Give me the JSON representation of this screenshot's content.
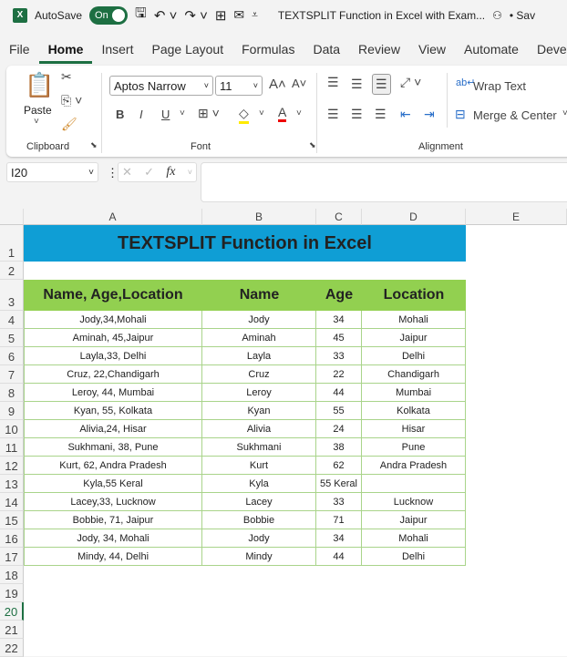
{
  "titlebar": {
    "autosave_label": "AutoSave",
    "autosave_state": "On",
    "doc_title": "TEXTSPLIT Function in Excel with Exam...",
    "save_status": "• Sav"
  },
  "tabs": [
    "File",
    "Home",
    "Insert",
    "Page Layout",
    "Formulas",
    "Data",
    "Review",
    "View",
    "Automate",
    "Develo"
  ],
  "ribbon": {
    "paste": "Paste",
    "clipboard": "Clipboard",
    "font_name": "Aptos Narrow",
    "font_size": "11",
    "font": "Font",
    "alignment": "Alignment",
    "wrap_text": "Wrap Text",
    "merge_center": "Merge & Center",
    "bold": "B",
    "italic": "I",
    "underline": "U"
  },
  "formula_bar": {
    "name_box": "I20",
    "fx": "fx",
    "value": ""
  },
  "columns": [
    "A",
    "B",
    "C",
    "D",
    "E"
  ],
  "rows": [
    "1",
    "2",
    "3",
    "4",
    "5",
    "6",
    "7",
    "8",
    "9",
    "10",
    "11",
    "12",
    "13",
    "14",
    "15",
    "16",
    "17",
    "18",
    "19",
    "20",
    "21",
    "22"
  ],
  "sheet": {
    "title": "TEXTSPLIT Function in Excel",
    "headers": [
      "Name, Age,Location",
      "Name",
      "Age",
      "Location"
    ],
    "data": [
      [
        "Jody,34,Mohali",
        "Jody",
        "34",
        "Mohali"
      ],
      [
        "Aminah, 45,Jaipur",
        "Aminah",
        "45",
        "Jaipur"
      ],
      [
        "Layla,33, Delhi",
        "Layla",
        "33",
        "Delhi"
      ],
      [
        "Cruz, 22,Chandigarh",
        "Cruz",
        "22",
        "Chandigarh"
      ],
      [
        "Leroy, 44, Mumbai",
        "Leroy",
        "44",
        "Mumbai"
      ],
      [
        "Kyan, 55, Kolkata",
        "Kyan",
        "55",
        "Kolkata"
      ],
      [
        "Alivia,24, Hisar",
        "Alivia",
        "24",
        "Hisar"
      ],
      [
        "Sukhmani, 38, Pune",
        "Sukhmani",
        "38",
        "Pune"
      ],
      [
        "Kurt, 62, Andra Pradesh",
        "Kurt",
        "62",
        "Andra Pradesh"
      ],
      [
        "Kyla,55 Keral",
        "Kyla",
        "55 Keral",
        ""
      ],
      [
        "Lacey,33, Lucknow",
        "Lacey",
        "33",
        "Lucknow"
      ],
      [
        "Bobbie, 71, Jaipur",
        "Bobbie",
        "71",
        "Jaipur"
      ],
      [
        "Jody, 34, Mohali",
        "Jody",
        "34",
        "Mohali"
      ],
      [
        "Mindy, 44, Delhi",
        "Mindy",
        "44",
        "Delhi"
      ]
    ]
  },
  "colors": {
    "title_fill": "#0f9ed5",
    "header_fill": "#92d050",
    "accent": "#1d6f42"
  }
}
